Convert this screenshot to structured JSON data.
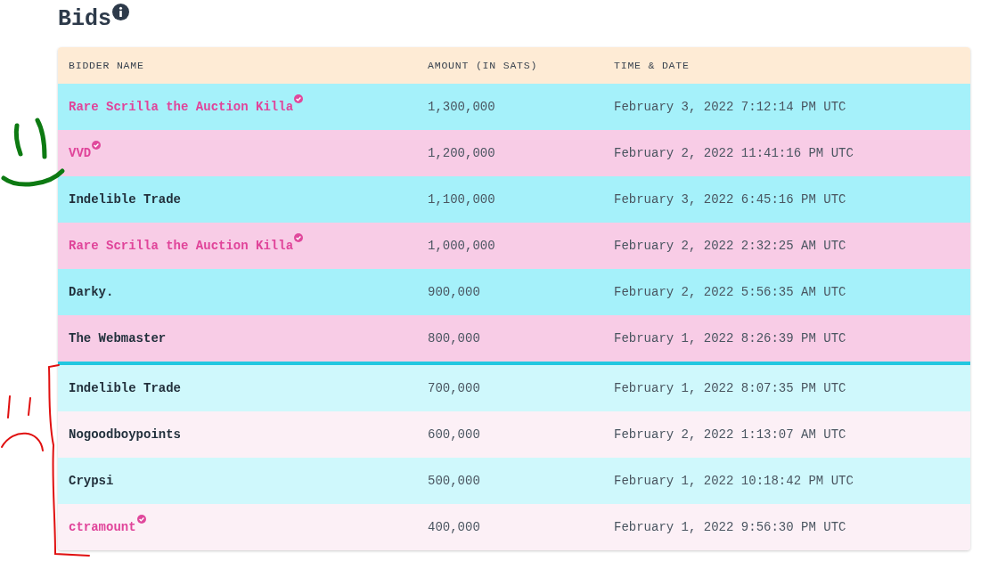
{
  "title": "Bids",
  "table": {
    "columns": [
      "BIDDER NAME",
      "AMOUNT (IN SATS)",
      "TIME & DATE"
    ],
    "rows": [
      {
        "bidder": "Rare Scrilla the Auction Killa",
        "verified": true,
        "muted": false,
        "amount": "1,300,000",
        "time": "February 3, 2022 7:12:14 PM UTC"
      },
      {
        "bidder": "VVD",
        "verified": true,
        "muted": false,
        "amount": "1,200,000",
        "time": "February 2, 2022 11:41:16 PM UTC"
      },
      {
        "bidder": "Indelible Trade",
        "verified": false,
        "muted": false,
        "amount": "1,100,000",
        "time": "February 3, 2022 6:45:16 PM UTC"
      },
      {
        "bidder": "Rare Scrilla the Auction Killa",
        "verified": true,
        "muted": false,
        "amount": "1,000,000",
        "time": "February 2, 2022 2:32:25 AM UTC"
      },
      {
        "bidder": "Darky.",
        "verified": false,
        "muted": false,
        "amount": "900,000",
        "time": "February 2, 2022 5:56:35 AM UTC"
      },
      {
        "bidder": "The Webmaster",
        "verified": false,
        "muted": false,
        "amount": "800,000",
        "time": "February 1, 2022 8:26:39 PM UTC"
      },
      {
        "bidder": "Indelible Trade",
        "verified": false,
        "muted": true,
        "amount": "700,000",
        "time": "February 1, 2022 8:07:35 PM UTC"
      },
      {
        "bidder": "Nogoodboypoints",
        "verified": false,
        "muted": true,
        "amount": "600,000",
        "time": "February 2, 2022 1:13:07 AM UTC"
      },
      {
        "bidder": "Crypsi",
        "verified": false,
        "muted": true,
        "amount": "500,000",
        "time": "February 1, 2022 10:18:42 PM UTC"
      },
      {
        "bidder": "ctramount",
        "verified": true,
        "muted": true,
        "amount": "400,000",
        "time": "February 1, 2022 9:56:30 PM UTC"
      }
    ]
  }
}
